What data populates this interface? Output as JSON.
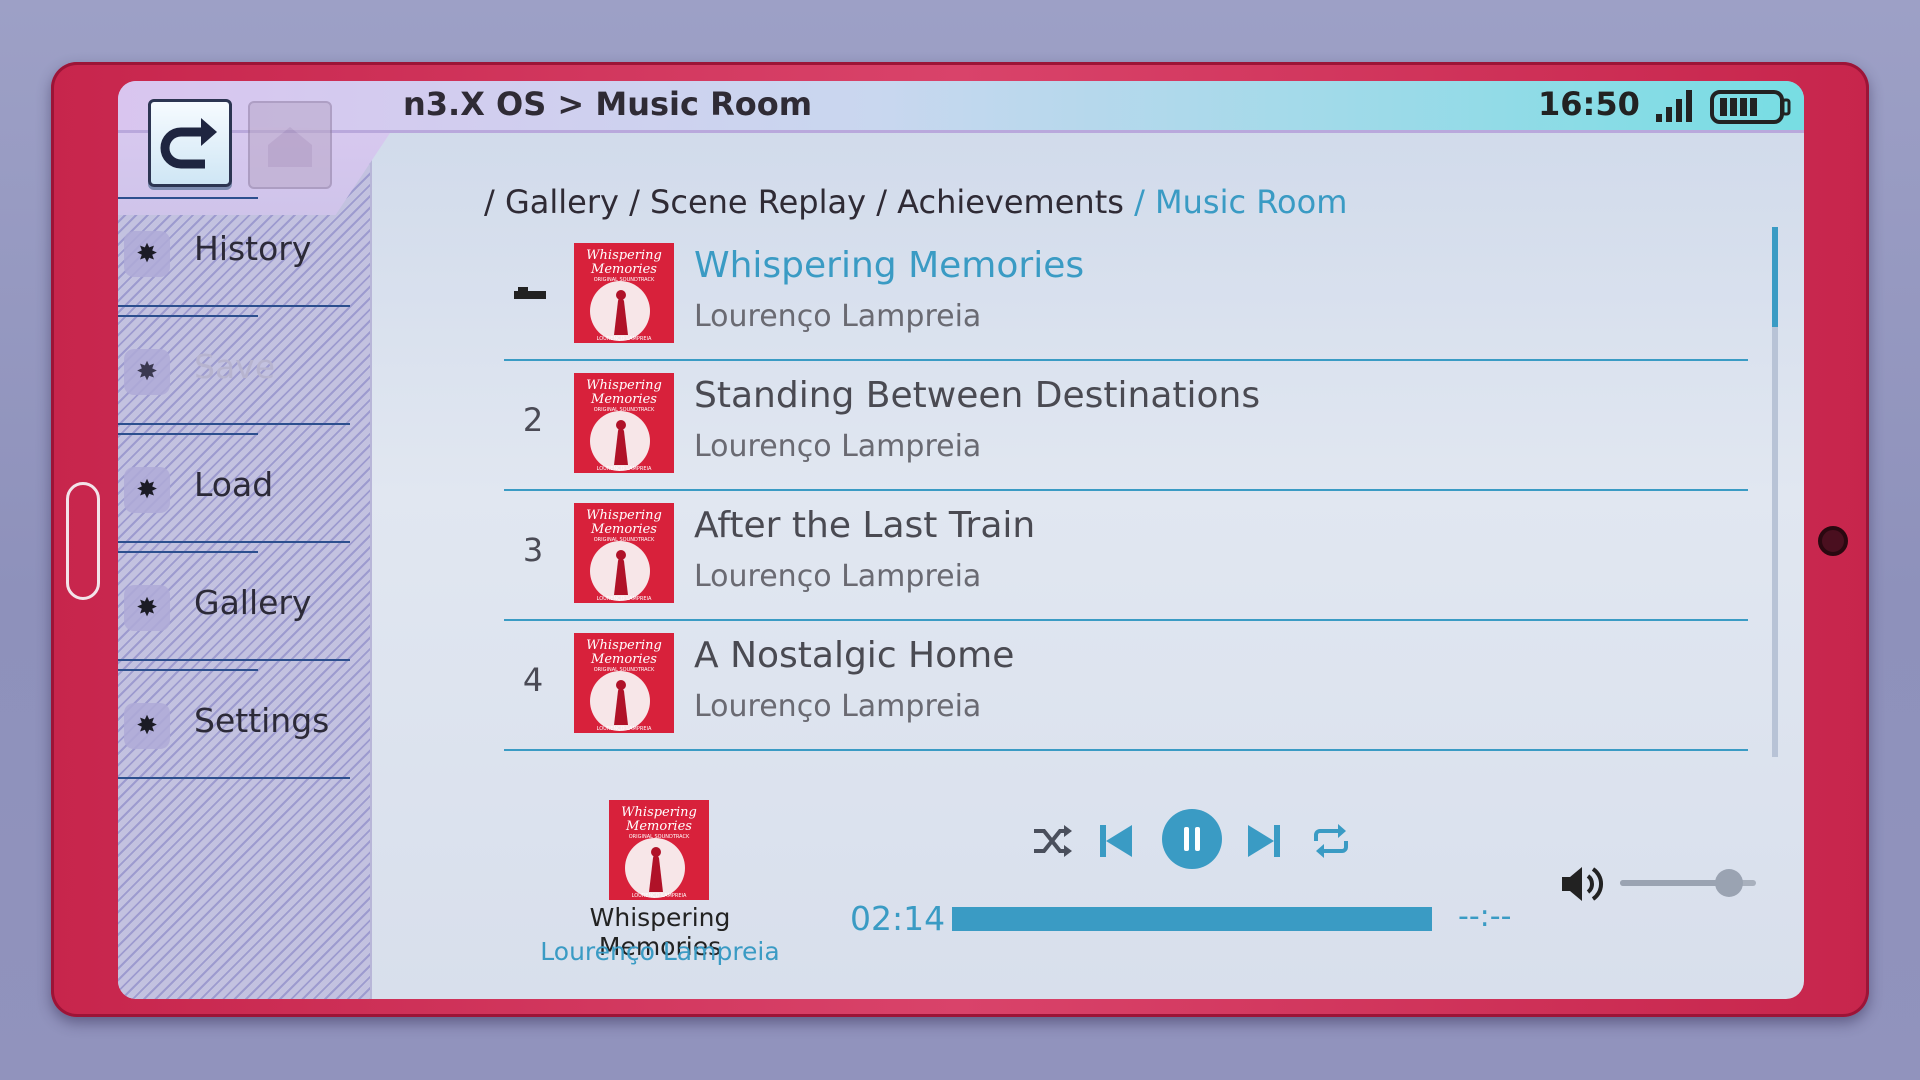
{
  "topbar": {
    "title": "n3.X OS > Music Room",
    "clock": "16:50"
  },
  "sidebar": {
    "items": [
      {
        "label": "History",
        "enabled": true
      },
      {
        "label": "Save",
        "enabled": false
      },
      {
        "label": "Load",
        "enabled": true
      },
      {
        "label": "Gallery",
        "enabled": true
      },
      {
        "label": "Settings",
        "enabled": true
      }
    ]
  },
  "breadcrumb": {
    "gallery": "/ Gallery",
    "scene_replay": "/ Scene Replay",
    "achievements": "/ Achievements",
    "current": "/ Music Room"
  },
  "tracks": [
    {
      "number": "",
      "title": "Whispering Memories",
      "artist": "Lourenço Lampreia",
      "active": true
    },
    {
      "number": "2",
      "title": "Standing Between Destinations",
      "artist": "Lourenço Lampreia",
      "active": false
    },
    {
      "number": "3",
      "title": "After the Last Train",
      "artist": "Lourenço Lampreia",
      "active": false
    },
    {
      "number": "4",
      "title": "A Nostalgic Home",
      "artist": "Lourenço Lampreia",
      "active": false
    }
  ],
  "album_art": {
    "line1": "Whispering",
    "line2": "Memories",
    "subtitle": "ORIGINAL SOUNDTRACK",
    "credit": "LOURENÇO LAMPREIA"
  },
  "player": {
    "title": "Whispering Memories",
    "artist": "Lourenço Lampreia",
    "elapsed": "02:14",
    "total": "--:--",
    "progress": 1.0,
    "volume": 0.8,
    "state": "playing"
  },
  "colors": {
    "accent": "#3a9bc4",
    "frame": "#c7254c",
    "sidebar": "#c3c2e0"
  },
  "icons": {
    "back": "back-arrow-icon",
    "home": "home-icon",
    "nav": "star-icon",
    "shuffle": "shuffle-icon",
    "previous": "skip-previous-icon",
    "pause": "pause-icon",
    "next": "skip-next-icon",
    "repeat": "repeat-icon",
    "volume": "volume-icon",
    "signal": "signal-icon",
    "battery": "battery-icon"
  }
}
